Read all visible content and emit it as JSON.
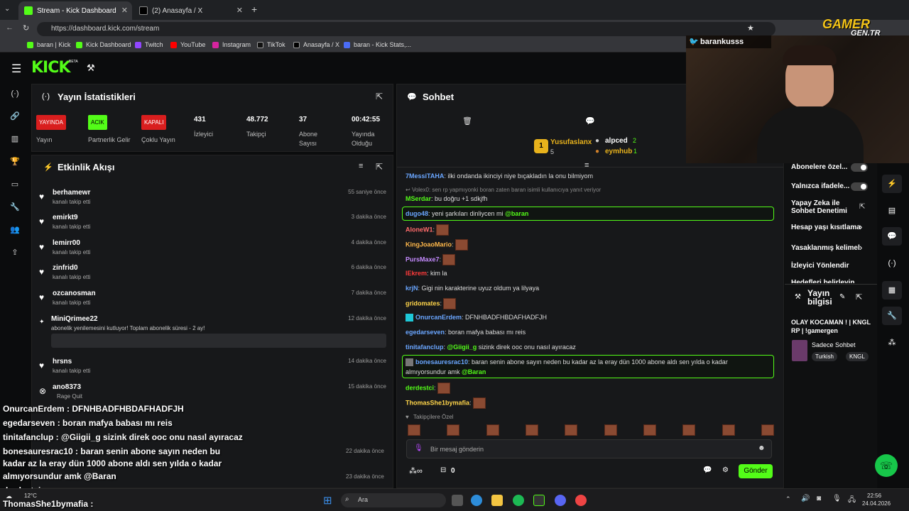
{
  "browser": {
    "tabs": [
      {
        "title": "Stream - Kick Dashboard"
      },
      {
        "title": "(2) Anasayfa / X"
      }
    ],
    "url": "https://dashboard.kick.com/stream",
    "bookmarks": [
      "baran | Kick",
      "Kick Dashboard",
      "Twitch",
      "YouTube",
      "Instagram",
      "TikTok",
      "Anasayfa / X",
      "baran - Kick Stats,..."
    ]
  },
  "kick": {
    "logo": "KICK",
    "logo_badge": "BETA"
  },
  "stats_panel": {
    "title": "Yayın İstatistikleri",
    "items": [
      {
        "badge": "YAYINDA",
        "label": "Yayın",
        "badge_color": "#d91e1e"
      },
      {
        "badge": "ACIK",
        "label": "Partnerlik Gelir",
        "badge_color": "#53fc18"
      },
      {
        "badge": "KAPALI",
        "label": "Çoklu Yayın",
        "badge_color": "#d91e1e"
      },
      {
        "value": "431",
        "label": "İzleyici"
      },
      {
        "value": "48.772",
        "label": "Takipçi"
      },
      {
        "value": "37",
        "label": "Abone Sayısı"
      },
      {
        "value": "00:42:55",
        "label": "Yayında Olduğu"
      }
    ]
  },
  "activity": {
    "title": "Etkinlik Akışı",
    "events": [
      {
        "name": "berhamewr",
        "sub": "kanalı takip etti",
        "time": "55 saniye önce"
      },
      {
        "name": "emirkt9",
        "sub": "kanalı takip etti",
        "time": "3 dakika önce"
      },
      {
        "name": "lemirr00",
        "sub": "kanalı takip etti",
        "time": "4 dakika önce"
      },
      {
        "name": "zinfrid0",
        "sub": "kanalı takip etti",
        "time": "6 dakika önce"
      },
      {
        "name": "ozcanosman",
        "sub": "kanalı takip etti",
        "time": "7 dakika önce"
      },
      {
        "name": "MiniQrimee22",
        "sub": "abonelik yenilemesini kutluyor! Toplam abonelik süresi - 2 ay!",
        "time": "12 dakika önce"
      },
      {
        "name": "hrsns",
        "sub": "kanalı takip etti",
        "time": "14 dakika önce"
      },
      {
        "name": "ano8373",
        "sub": "Rage Quit",
        "time": "15 dakika önce"
      }
    ],
    "extra_times": [
      "22 dakika önce",
      "23 dakika önce"
    ]
  },
  "chat": {
    "title": "Sohbet",
    "leaders": [
      {
        "name": "Yusufaslanx",
        "count": "5",
        "rank": "1"
      },
      {
        "name": "alpced",
        "count": "2"
      },
      {
        "name": "eymhub",
        "count": "1"
      }
    ],
    "messages": [
      {
        "user": "7MessiTAHA",
        "text": ": ilki ondanda ikinciyi niye bıçakladın la onu bilmiyom",
        "color": "#6aa6ff"
      },
      {
        "user": "",
        "text": "Volex0: sen rp yapmıyonki boran zaten baran isimli kullanıcıya yanıt veriyor",
        "color": "#888"
      },
      {
        "user": "MSerdar",
        "text": ": bu doğru +1 sdkjfh",
        "color": "#53fc18"
      },
      {
        "user": "dugo48",
        "text": ": yeni şarkıları dinliycen mi ",
        "mention": "@baran",
        "color": "#6aa6ff"
      },
      {
        "user": "AloneW1",
        "text": ":",
        "color": "#ff6b6b"
      },
      {
        "user": "KingJoaoMario",
        "text": ":",
        "color": "#ffb84a"
      },
      {
        "user": "PursMaxe7",
        "text": ":",
        "color": "#c58bff"
      },
      {
        "user": "lEkrem",
        "text": ": kim la",
        "color": "#ff3b3b"
      },
      {
        "user": "krjN",
        "text": ": Gigi nin karakterine uyuz oldum ya lilyaya",
        "color": "#6aa6ff"
      },
      {
        "user": "gridomates",
        "text": ":",
        "color": "#ffd54a"
      },
      {
        "user": "OnurcanErdem",
        "text": ": DFNHBADFHBDAFHADFJH",
        "color": "#6aa6ff"
      },
      {
        "user": "egedarseven",
        "text": ": boran mafya babası mı reis",
        "color": "#6aa6ff"
      },
      {
        "user": "tinitafanclup",
        "text": ": ",
        "mention": "@Giigii_g",
        "text2": " sizink direk ooc onu nasıl ayıracaz",
        "color": "#6aa6ff"
      },
      {
        "user": "bonesauresrac10",
        "text": ": baran senin abone sayın neden bu kadar az la eray dün 1000 abone aldı sen yılda o kadar",
        "text2": "almıyorsundur amk ",
        "mention": "@Baran",
        "color": "#6aa6ff"
      },
      {
        "user": "derdestci",
        "text": ":",
        "color": "#53fc18"
      },
      {
        "user": "ThomasShe1bymafia",
        "text": ":",
        "color": "#ffd54a"
      }
    ],
    "followers_label": "Takipçilere Özel",
    "input_placeholder": "Bir mesaj gönderin",
    "points": "0",
    "send_label": "Gönder"
  },
  "overlay": {
    "channel": "barankusss",
    "watermark_top": "GAMER",
    "watermark_bottom": "GEN.TR",
    "lines": [
      "OnurcanErdem : DFNHBADFHBDAFHADFJH",
      "egedarseven : boran mafya babası mı reis",
      "tinitafanclup : @Giigii_g sizink direk ooc onu nasıl ayıracaz",
      "bonesauresrac10 : baran senin abone sayın neden bu",
      "kadar az la eray dün 1000 abone aldı sen yılda o kadar",
      "almıyorsundur amk @Baran",
      "derdestci :",
      "ThomasShe1bymafia :"
    ]
  },
  "settings": {
    "items": [
      "Abonelere özel...",
      "Yalnızca ifadele...",
      "Yapay Zeka ile Sohbet Denetimi",
      "Hesap yaşı kısıtlama",
      "Yasaklanmış kelimel",
      "İzleyici Yönlendir",
      "Hedefleri belirleyin"
    ],
    "stream_info_title": "Yayın bilgisi",
    "stream_title": "OLAY KOCAMAN ! | KNGL RP | !gamergen",
    "category": "Sadece Sohbet",
    "tags": [
      "Turkish",
      "KNGL"
    ]
  },
  "taskbar": {
    "search": "Ara",
    "weather": "12°C",
    "time": "22:56",
    "date": "24.04.2026"
  }
}
